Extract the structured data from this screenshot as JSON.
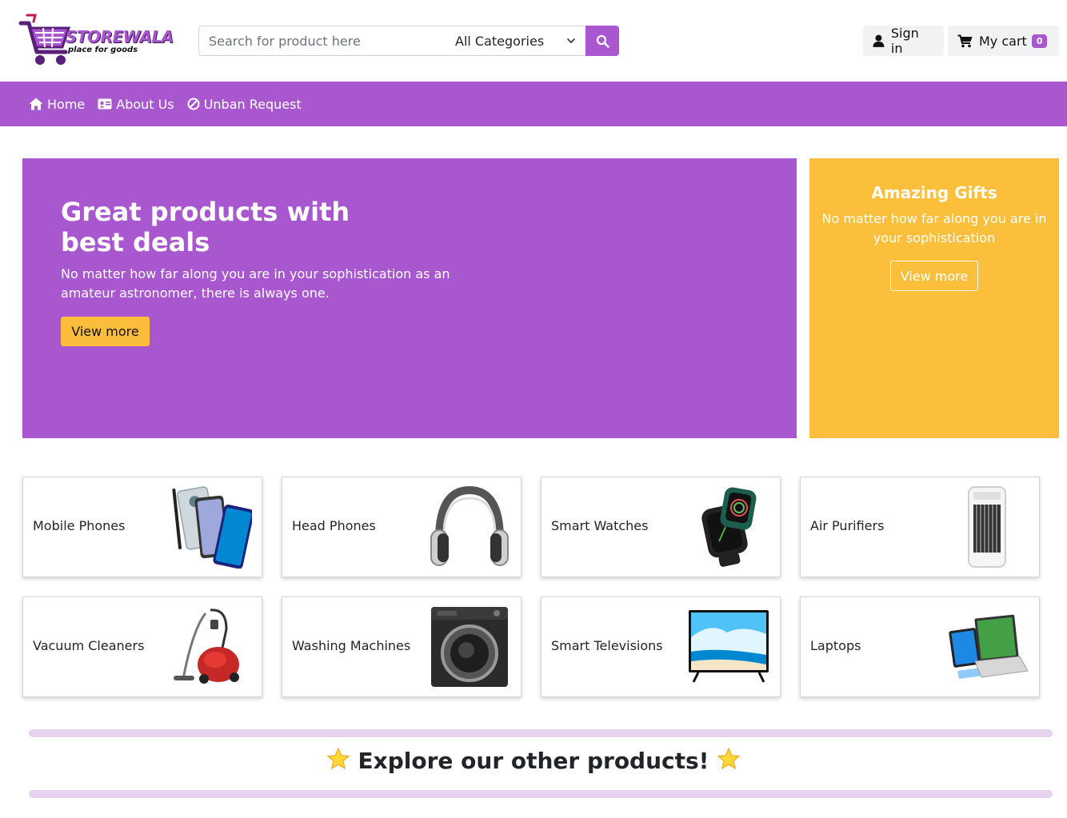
{
  "brand": {
    "name": "STOREWALA",
    "tagline": "place for goods",
    "accent": "#a957cf",
    "secondary": "#fbbd3b"
  },
  "search": {
    "placeholder": "Search for product here",
    "value": "",
    "category_selected": "All Categories",
    "button_icon": "search-icon"
  },
  "header": {
    "signin_label": "Sign in",
    "cart_label": "My cart",
    "cart_count": "0"
  },
  "nav": {
    "items": [
      {
        "label": "Home",
        "icon": "home-icon"
      },
      {
        "label": "About Us",
        "icon": "id-card-icon"
      },
      {
        "label": "Unban Request",
        "icon": "ban-icon"
      }
    ]
  },
  "hero": {
    "title": "Great products with best deals",
    "text": "No matter how far along you are in your sophistication as an amateur astronomer, there is always one.",
    "button_label": "View more"
  },
  "gift": {
    "title": "Amazing Gifts",
    "text": "No matter how far along you are in your sophistication",
    "button_label": "View more"
  },
  "categories": [
    {
      "label": "Mobile Phones",
      "icon": "mobile-phones-image"
    },
    {
      "label": "Head Phones",
      "icon": "headphones-image"
    },
    {
      "label": "Smart Watches",
      "icon": "smart-watch-image"
    },
    {
      "label": "Air Purifiers",
      "icon": "air-purifier-image"
    },
    {
      "label": "Vacuum Cleaners",
      "icon": "vacuum-cleaner-image"
    },
    {
      "label": "Washing Machines",
      "icon": "washing-machine-image"
    },
    {
      "label": "Smart Televisions",
      "icon": "television-image"
    },
    {
      "label": "Laptops",
      "icon": "laptop-image"
    }
  ],
  "explore": {
    "text": "Explore our other products!"
  }
}
